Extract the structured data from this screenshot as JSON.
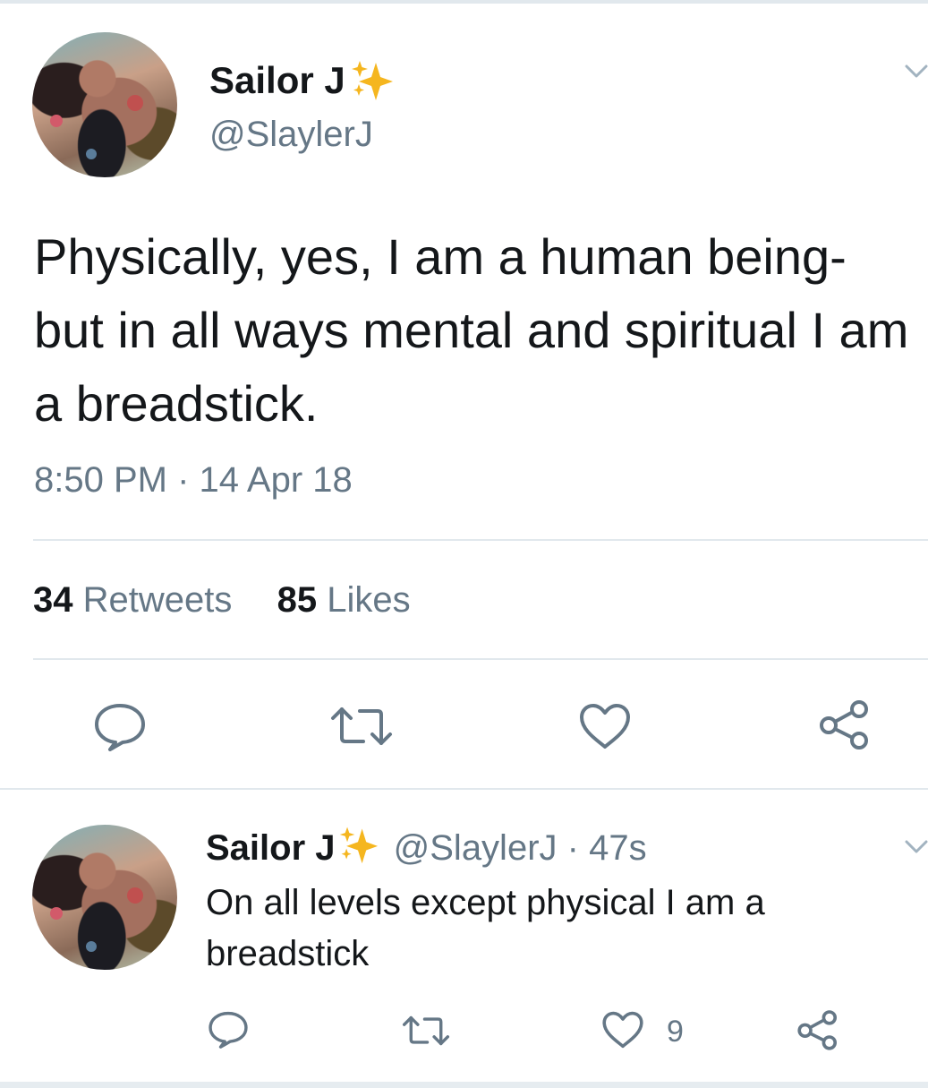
{
  "main_tweet": {
    "display_name": "Sailor J",
    "name_emoji": "sparkles-icon",
    "handle": "@SlaylerJ",
    "text": "Physically, yes, I am a human being- but in all ways mental and spiritual I am a breadstick.",
    "timestamp": "8:50 PM · 14 Apr 18",
    "retweets_count": "34",
    "retweets_label": "Retweets",
    "likes_count": "85",
    "likes_label": "Likes"
  },
  "reply_tweet": {
    "display_name": "Sailor J",
    "handle": "@SlaylerJ",
    "separator": "·",
    "time_ago": "47s",
    "text": "On all levels except physical I am a breadstick",
    "like_count": "9"
  },
  "colors": {
    "text_primary": "#14171a",
    "text_secondary": "#657786",
    "divider": "#e1e8ed",
    "sparkle": "#f5b61f"
  }
}
